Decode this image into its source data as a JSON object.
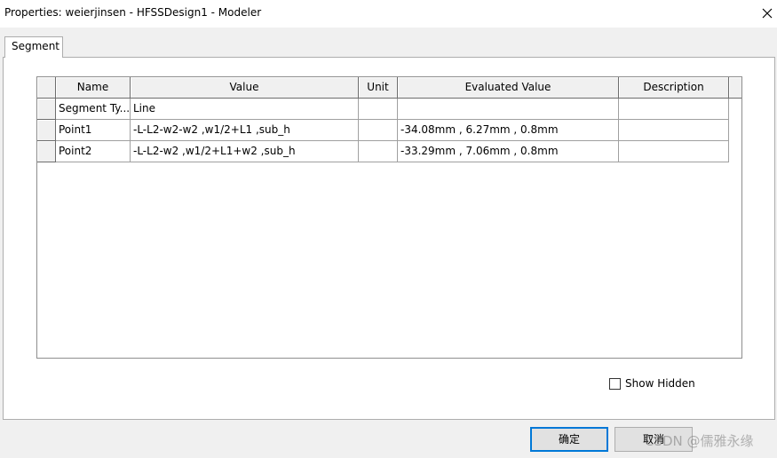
{
  "window": {
    "title": "Properties: weierjinsen - HFSSDesign1 - Modeler",
    "close_icon": "close-icon"
  },
  "tabs": [
    {
      "label": "Segment"
    }
  ],
  "grid": {
    "columns": [
      "Name",
      "Value",
      "Unit",
      "Evaluated Value",
      "Description"
    ],
    "rows": [
      {
        "name": "Segment Ty...",
        "value": "Line",
        "unit": "",
        "evaluated": "",
        "description": ""
      },
      {
        "name": "Point1",
        "value": "-L-L2-w2-w2 ,w1/2+L1 ,sub_h",
        "unit": "",
        "evaluated": "-34.08mm , 6.27mm , 0.8mm",
        "description": ""
      },
      {
        "name": "Point2",
        "value": "-L-L2-w2 ,w1/2+L1+w2 ,sub_h",
        "unit": "",
        "evaluated": "-33.29mm , 7.06mm , 0.8mm",
        "description": ""
      }
    ]
  },
  "show_hidden": {
    "label": "Show Hidden",
    "checked": false
  },
  "buttons": {
    "ok": "确定",
    "cancel": "取消"
  },
  "watermark": "CSDN @儒雅永缘"
}
